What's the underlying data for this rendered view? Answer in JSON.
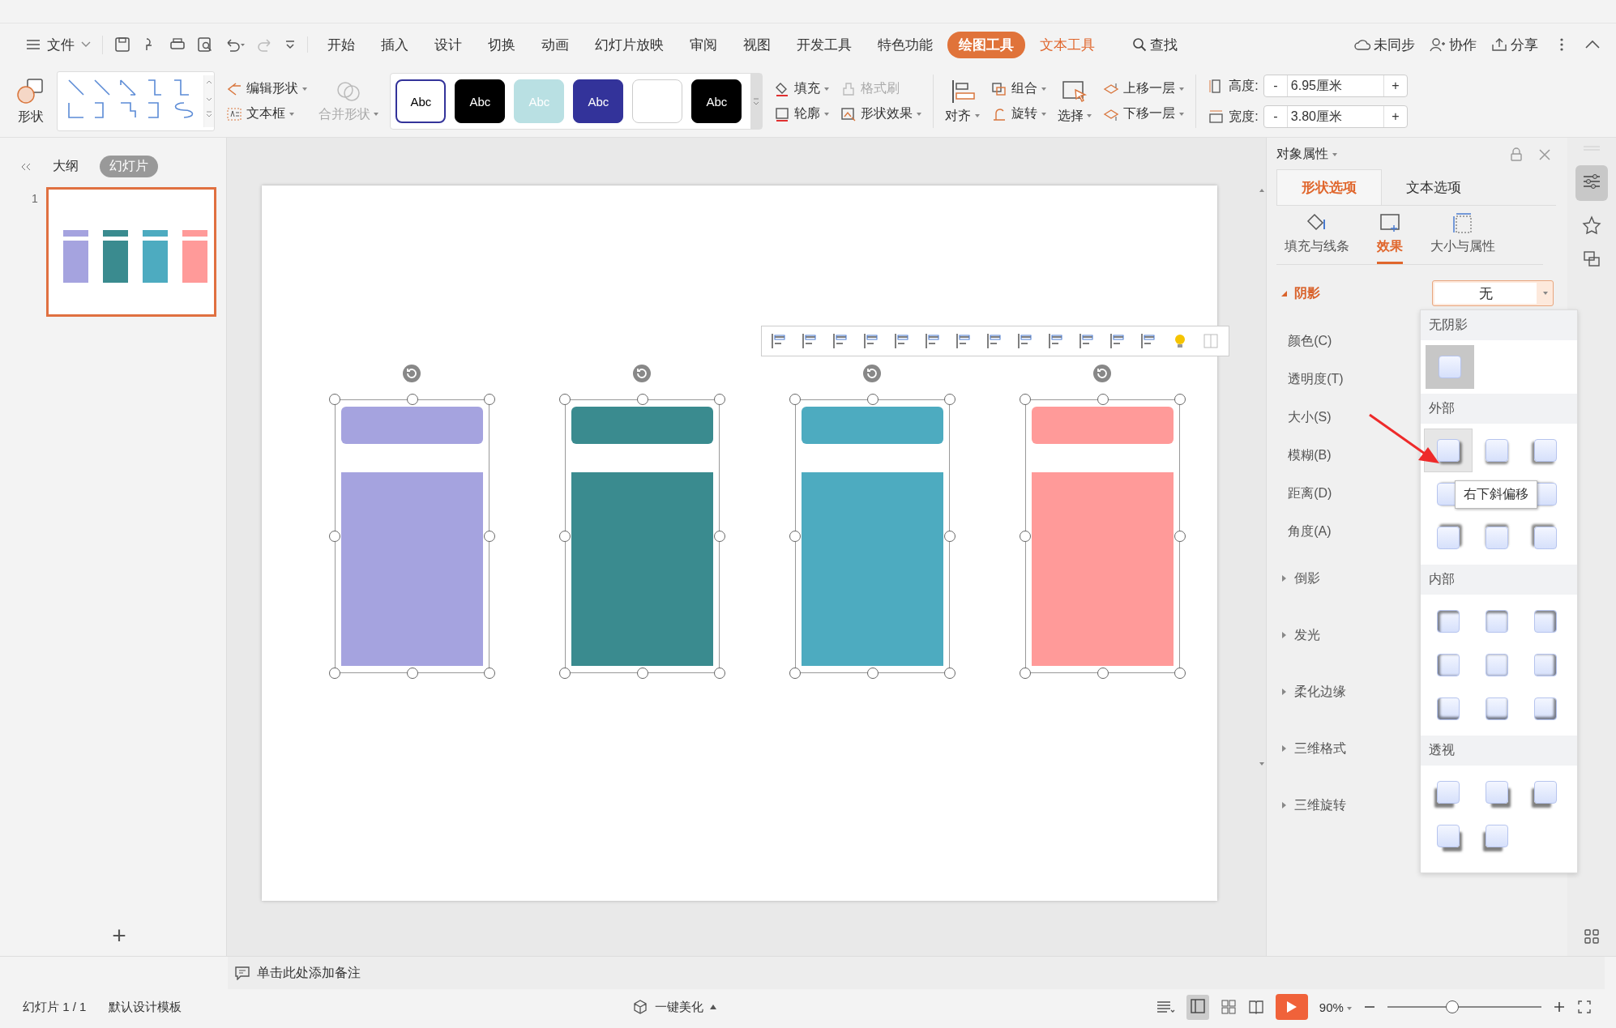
{
  "file_menu": "文件",
  "tabs": [
    {
      "label": "开始",
      "selected": false,
      "kind": "normal"
    },
    {
      "label": "插入",
      "selected": false,
      "kind": "normal"
    },
    {
      "label": "设计",
      "selected": false,
      "kind": "normal"
    },
    {
      "label": "切换",
      "selected": false,
      "kind": "normal"
    },
    {
      "label": "动画",
      "selected": false,
      "kind": "normal"
    },
    {
      "label": "幻灯片放映",
      "selected": false,
      "kind": "normal"
    },
    {
      "label": "审阅",
      "selected": false,
      "kind": "normal"
    },
    {
      "label": "视图",
      "selected": false,
      "kind": "normal"
    },
    {
      "label": "开发工具",
      "selected": false,
      "kind": "normal"
    },
    {
      "label": "特色功能",
      "selected": false,
      "kind": "normal"
    },
    {
      "label": "绘图工具",
      "selected": true,
      "kind": "contextual"
    },
    {
      "label": "文本工具",
      "selected": false,
      "kind": "contextual"
    }
  ],
  "search": {
    "label": "查找"
  },
  "account": [
    {
      "label": "未同步",
      "kind": "cloud"
    },
    {
      "label": "协作",
      "kind": "user"
    },
    {
      "label": "分享",
      "kind": "share"
    }
  ],
  "ribbon": {
    "shape": "形状",
    "edit_shape": "编辑形状",
    "text_box": "文本框",
    "merge_shapes": {
      "label": "合并形状",
      "disabled": true
    },
    "styles": [
      {
        "label": "Abc",
        "color": "#ffffff",
        "kind": "outlined"
      },
      {
        "label": "Abc",
        "color": "#000000",
        "kind": "filled"
      },
      {
        "label": "Abc",
        "color": "#b9e0e3",
        "kind": "filled"
      },
      {
        "label": "Abc",
        "color": "#33339a",
        "kind": "filled"
      },
      {
        "color": "#ffffff",
        "kind": "filled"
      },
      {
        "label": "Abc",
        "color": "#000000",
        "kind": "filled"
      }
    ],
    "fill": "填充",
    "format_painter": {
      "label": "格式刷",
      "disabled": true
    },
    "outline": "轮廓",
    "shape_effects": "形状效果",
    "align": "对齐",
    "group": "组合",
    "rotate": "旋转",
    "select": "选择",
    "bring_forward": "上移一层",
    "send_backward": "下移一层",
    "size_fields": [
      {
        "label": "高度:",
        "value": "6.95厘米",
        "decrement": "-",
        "increment": "+",
        "kind": "height"
      },
      {
        "label": "宽度:",
        "value": "3.80厘米",
        "decrement": "-",
        "increment": "+",
        "kind": "width"
      }
    ]
  },
  "left_panel": {
    "tabs": [
      {
        "label": "大纲",
        "selected": false
      },
      {
        "label": "幻灯片",
        "selected": true
      }
    ],
    "slides": [
      {
        "number": "1",
        "selected": true
      }
    ],
    "add": "+"
  },
  "slide": {
    "shapes": [
      {
        "color": "#a5a3df",
        "selected": true
      },
      {
        "color": "#3a8b8f",
        "selected": true
      },
      {
        "color": "#4dabc0",
        "selected": true
      },
      {
        "color": "#ff9a99",
        "selected": true
      }
    ]
  },
  "notes": {
    "placeholder": "单击此处添加备注"
  },
  "properties": {
    "title": "对象属性",
    "tabs": [
      {
        "label": "形状选项",
        "selected": true
      },
      {
        "label": "文本选项",
        "selected": false
      }
    ],
    "subtabs": [
      {
        "label": "填充与线条",
        "selected": false,
        "kind": "fill"
      },
      {
        "label": "效果",
        "selected": true,
        "kind": "effects"
      },
      {
        "label": "大小与属性",
        "selected": false,
        "kind": "size"
      }
    ],
    "sections": [
      {
        "label": "阴影",
        "expanded": true,
        "value": "无",
        "fields": [
          "颜色(C)",
          "透明度(T)",
          "大小(S)",
          "模糊(B)",
          "距离(D)",
          "角度(A)"
        ]
      },
      {
        "label": "倒影",
        "expanded": false
      },
      {
        "label": "发光",
        "expanded": false
      },
      {
        "label": "柔化边缘",
        "expanded": false
      },
      {
        "label": "三维格式",
        "expanded": false
      },
      {
        "label": "三维旋转",
        "expanded": false
      }
    ]
  },
  "shadow_menu": {
    "groups": [
      {
        "label": "无阴影",
        "kind": "none",
        "items": [
          {
            "selected": true,
            "hovered": false
          }
        ]
      },
      {
        "label": "外部",
        "kind": "outer",
        "items": [
          {
            "selected": false,
            "hovered": true
          },
          {
            "selected": false,
            "hovered": false
          },
          {
            "selected": false,
            "hovered": false
          },
          {
            "selected": false,
            "hovered": false
          },
          {
            "selected": false,
            "hovered": false
          },
          {
            "selected": false,
            "hovered": false
          },
          {
            "selected": false,
            "hovered": false
          },
          {
            "selected": false,
            "hovered": false
          }
        ]
      },
      {
        "label": "内部",
        "kind": "inner",
        "items": [
          {
            "selected": false,
            "hovered": false
          },
          {
            "selected": false,
            "hovered": false
          },
          {
            "selected": false,
            "hovered": false
          },
          {
            "selected": false,
            "hovered": false
          },
          {
            "selected": false,
            "hovered": false
          },
          {
            "selected": false,
            "hovered": false
          },
          {
            "selected": false,
            "hovered": false
          },
          {
            "selected": false,
            "hovered": false
          },
          {
            "selected": false,
            "hovered": false
          }
        ]
      },
      {
        "label": "透视",
        "kind": "perspective",
        "items": [
          {
            "selected": false,
            "hovered": false
          },
          {
            "selected": false,
            "hovered": false
          },
          {
            "selected": false,
            "hovered": false
          },
          {
            "selected": false,
            "hovered": false
          },
          {
            "selected": false,
            "hovered": false
          }
        ]
      }
    ],
    "tooltip": "右下斜偏移"
  },
  "status_bar": {
    "slide": "幻灯片 1 / 1",
    "template": "默认设计模板",
    "beautify": "一键美化",
    "zoom": "90%",
    "zoom_slider": {
      "level": 0.42
    }
  }
}
